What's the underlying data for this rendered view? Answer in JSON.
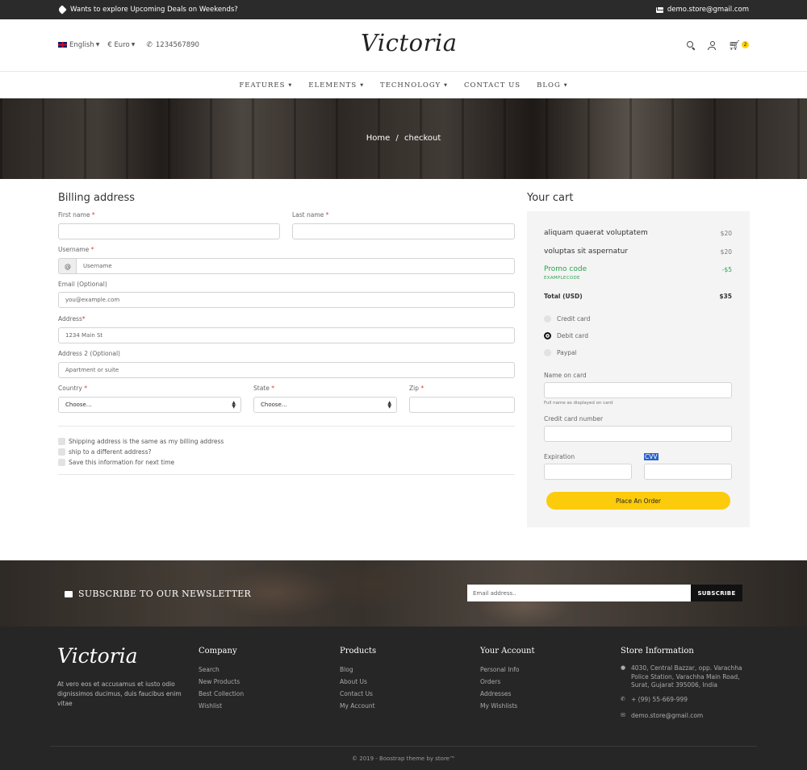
{
  "topbar": {
    "promo": "Wants to explore Upcoming Deals on Weekends?",
    "email": "demo.store@gmail.com"
  },
  "header": {
    "language": "English",
    "currency": "€ Euro",
    "phone": "1234567890",
    "logo": "Victoria",
    "cart_count": "2"
  },
  "nav": {
    "items": [
      {
        "label": "FEATURES",
        "dropdown": true
      },
      {
        "label": "ELEMENTS",
        "dropdown": true
      },
      {
        "label": "TECHNOLOGY",
        "dropdown": true
      },
      {
        "label": "CONTACT US",
        "dropdown": false
      },
      {
        "label": "BLOG",
        "dropdown": true
      }
    ]
  },
  "hero": {
    "crumb_home": "Home",
    "crumb_sep": "/",
    "crumb_current": "checkout"
  },
  "billing": {
    "title": "Billing address",
    "first_name_label": "First name",
    "last_name_label": "Last name",
    "username_label": "Username",
    "username_prefix": "@",
    "username_placeholder": "Username",
    "email_label": "Email (Optional)",
    "email_placeholder": "you@example.com",
    "address_label": "Address",
    "address_placeholder": "1234 Main St",
    "address2_label": "Address 2 (Optional)",
    "address2_placeholder": "Apartment or suite",
    "country_label": "Country",
    "country_value": "Choose...",
    "state_label": "State",
    "state_value": "Choose...",
    "zip_label": "Zip",
    "required_mark": "*",
    "checkboxes": [
      "Shipping address is the same as my billing address",
      "ship to a different address?",
      "Save this information for next time"
    ]
  },
  "cart": {
    "title": "Your cart",
    "items": [
      {
        "name": "aliquam quaerat voluptatem",
        "price": "$20"
      },
      {
        "name": "voluptas sit aspernatur",
        "price": "$20"
      }
    ],
    "promo_label": "Promo code",
    "promo_code": "EXAMPLECODE",
    "promo_value": "-$5",
    "total_label": "Total (USD)",
    "total_value": "$35",
    "payment_options": [
      "Credit card",
      "Debit card",
      "Paypal"
    ],
    "payment_selected": "Debit card",
    "name_on_card_label": "Name on card",
    "name_on_card_hint": "Full name as displayed on card",
    "card_number_label": "Credit card number",
    "expiration_label": "Expiration",
    "cvv_label": "CVV",
    "order_button": "Place An Order"
  },
  "newsletter": {
    "title": "SUBSCRIBE TO OUR NEWSLETTER",
    "placeholder": "Email address..",
    "button": "SUBSCRIBE"
  },
  "footer": {
    "logo": "Victoria",
    "about": "At vero eos et accusamus et iusto odio dignissimos ducimus, duis faucibus enim vitae",
    "columns": [
      {
        "title": "Company",
        "links": [
          "Search",
          "New Products",
          "Best Collection",
          "Wishlist"
        ]
      },
      {
        "title": "Products",
        "links": [
          "Blog",
          "About Us",
          "Contact Us",
          "My Account"
        ]
      },
      {
        "title": "Your Account",
        "links": [
          "Personal Info",
          "Orders",
          "Addresses",
          "My Wishlists"
        ]
      }
    ],
    "store_title": "Store Information",
    "store_address": "4030, Central Bazzar, opp. Varachha Police Station, Varachha Main Road, Surat, Gujarat 395006, India",
    "store_phone": "+ (99) 55-669-999",
    "store_email": "demo.store@gmail.com",
    "copyright": "© 2019 - Boostrap theme by store™"
  }
}
